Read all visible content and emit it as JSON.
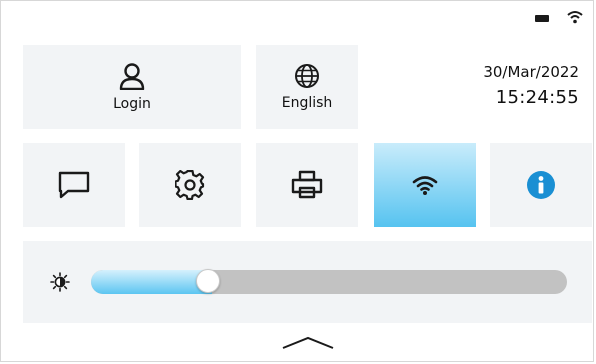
{
  "status_bar": {
    "battery_icon": "battery-icon",
    "wifi_icon": "wifi-icon"
  },
  "top_row": {
    "login": {
      "label": "Login",
      "icon": "user-icon"
    },
    "language": {
      "label": "English",
      "icon": "globe-icon"
    }
  },
  "datetime": {
    "date": "30/Mar/2022",
    "time": "15:24:55"
  },
  "shortcuts": [
    {
      "name": "messages",
      "icon": "chat-icon",
      "active": false
    },
    {
      "name": "settings",
      "icon": "gear-icon",
      "active": false
    },
    {
      "name": "print",
      "icon": "printer-icon",
      "active": false
    },
    {
      "name": "wifi",
      "icon": "wifi-icon",
      "active": true
    },
    {
      "name": "info",
      "icon": "info-icon",
      "active": false
    }
  ],
  "brightness": {
    "icon": "brightness-icon",
    "level": 0.23
  },
  "colors": {
    "accent": "#56c3f0",
    "tile": "#f2f4f6",
    "track": "#c2c2c2",
    "info": "#1a8fd3"
  }
}
